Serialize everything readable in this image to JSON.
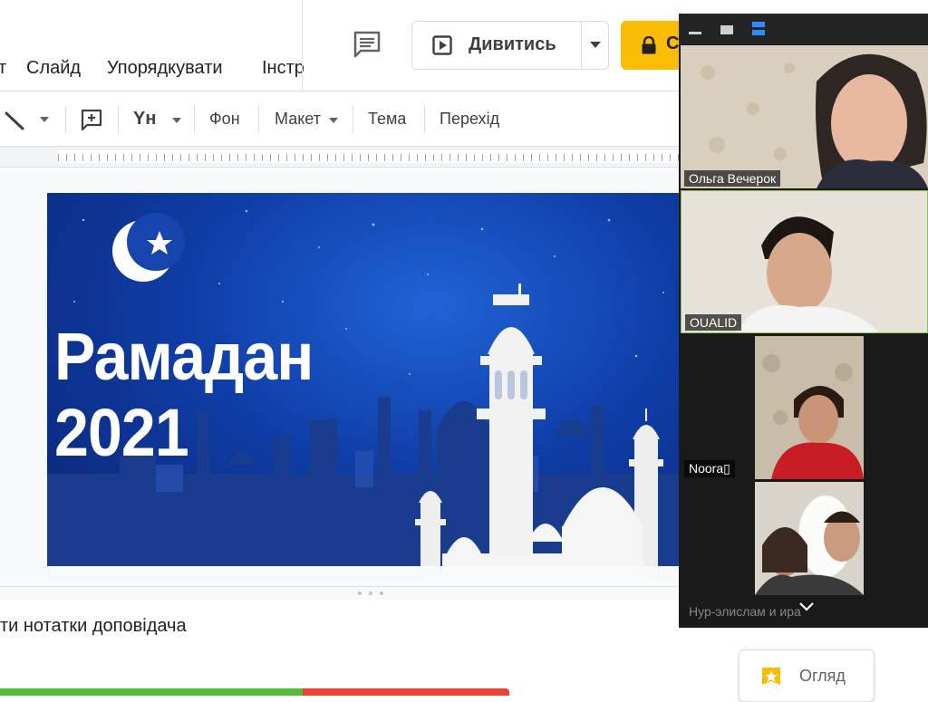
{
  "menu": {
    "items": [
      "т",
      "Слайд",
      "Упорядкувати",
      "Інстр"
    ]
  },
  "header": {
    "present_label": "Дивитись",
    "share_label": "С"
  },
  "toolbar": {
    "background_label": "Фон",
    "layout_label": "Макет",
    "theme_label": "Тема",
    "transition_label": "Перехід",
    "font_button_label": "Yн"
  },
  "slide": {
    "title_line1": "Рамадан",
    "title_line2": "2021"
  },
  "notes": {
    "placeholder": "ти нотатки доповідача"
  },
  "explore": {
    "label": "Огляд"
  },
  "zoom": {
    "participants": [
      {
        "name": "Ольга Вечерок"
      },
      {
        "name": "OUALID"
      },
      {
        "name": "Noora▯"
      },
      {
        "name": "Нур-элислам и ира"
      }
    ]
  },
  "colors": {
    "share_button": "#fbbc04",
    "progress_green": "#57bb3a",
    "progress_red": "#ea4335",
    "active_speaker_border": "#8bc34a"
  },
  "icons": [
    "comment-icon",
    "play-icon",
    "lock-icon",
    "line-tool-icon",
    "add-comment-icon",
    "explore-icon",
    "minimize-icon",
    "window-icon",
    "gallery-view-icon",
    "chevron-down-icon"
  ]
}
